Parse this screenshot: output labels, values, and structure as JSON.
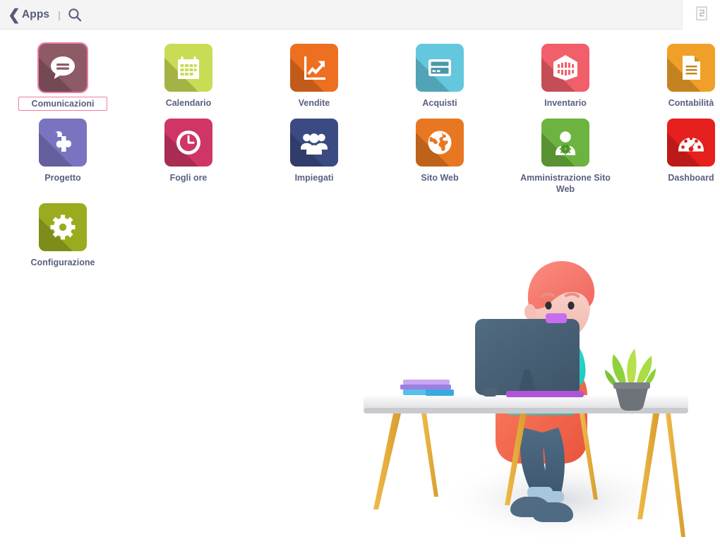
{
  "header": {
    "back_icon": "chevron-left-icon",
    "back_label": "Apps",
    "separator": "|",
    "search_icon": "search-icon",
    "corner_icon": "document-icon"
  },
  "apps": [
    {
      "label": "Comunicazioni",
      "icon": "speech-bubble-icon",
      "color": "#8d5a66",
      "focused": true
    },
    {
      "label": "Calendario",
      "icon": "calendar-icon",
      "color": "#cadb55",
      "focused": false
    },
    {
      "label": "Vendite",
      "icon": "chart-arrow-icon",
      "color": "#ed6f20",
      "focused": false
    },
    {
      "label": "Acquisti",
      "icon": "credit-card-icon",
      "color": "#63c7dd",
      "focused": false
    },
    {
      "label": "Inventario",
      "icon": "warehouse-icon",
      "color": "#f15f6a",
      "focused": false
    },
    {
      "label": "Contabilità",
      "icon": "document-icon",
      "color": "#f0a028",
      "focused": false
    },
    {
      "label": "Progetto",
      "icon": "puzzle-piece-icon",
      "color": "#7a74c0",
      "focused": false
    },
    {
      "label": "Fogli ore",
      "icon": "clock-icon",
      "color": "#cf3665",
      "focused": false
    },
    {
      "label": "Impiegati",
      "icon": "people-icon",
      "color": "#3b4a82",
      "focused": false
    },
    {
      "label": "Sito Web",
      "icon": "globe-icon",
      "color": "#e87722",
      "focused": false
    },
    {
      "label": "Amministrazione Sito Web",
      "icon": "user-gear-icon",
      "color": "#6cb33f",
      "focused": false
    },
    {
      "label": "Dashboard",
      "icon": "gauge-icon",
      "color": "#e5201e",
      "focused": false
    },
    {
      "label": "Configurazione",
      "icon": "gear-icon",
      "color": "#9aab1f",
      "focused": false
    }
  ],
  "illustration": {
    "name": "person-at-desk-illustration",
    "elements": [
      "desk",
      "monitor",
      "person",
      "chair",
      "plant",
      "books",
      "keyboard"
    ]
  }
}
